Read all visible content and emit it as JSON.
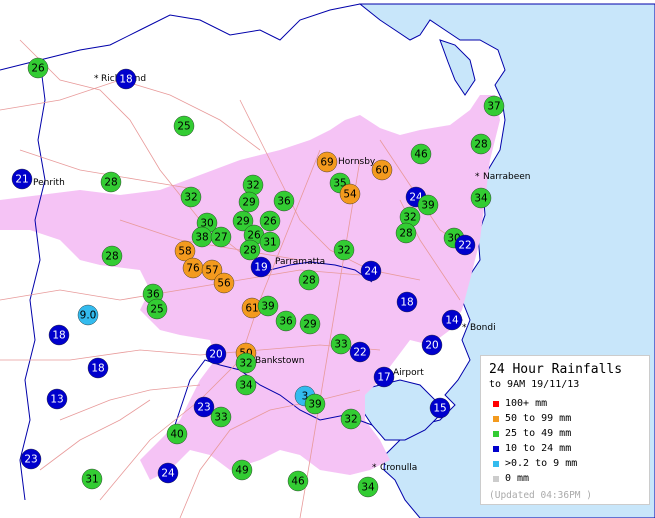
{
  "legend": {
    "title": "24 Hour Rainfalls",
    "subtitle": "to 9AM 19/11/13",
    "items": [
      {
        "label": "100+ mm",
        "color": "#ff0000"
      },
      {
        "label": "50  to 99 mm",
        "color": "#f39a1e"
      },
      {
        "label": "25  to 49 mm",
        "color": "#33cc33"
      },
      {
        "label": "10  to 24 mm",
        "color": "#0000cc"
      },
      {
        "label": ">0.2 to 9 mm",
        "color": "#33bbee"
      },
      {
        "label": "0 mm",
        "color": "#cccccc"
      }
    ],
    "updated": "(Updated 04:36PM  )"
  },
  "places": [
    "Richmond",
    "Penrith",
    "Narrabeen",
    "Hornsby",
    "Parramatta",
    "Bondi",
    "Bankstown",
    "Airport",
    "Cronulla"
  ],
  "stations": [
    "26",
    "18",
    "25",
    "37",
    "28",
    "69",
    "60",
    "46",
    "21",
    "28",
    "32",
    "32",
    "35",
    "54",
    "29",
    "36",
    "24",
    "39",
    "34",
    "30",
    "29",
    "26",
    "32",
    "28",
    "30",
    "38",
    "27",
    "26",
    "22",
    "31",
    "28",
    "58",
    "32",
    "28",
    "76",
    "57",
    "19",
    "28",
    "24",
    "56",
    "36",
    "25",
    "61",
    "39",
    "18",
    "14",
    "9.0",
    "36",
    "29",
    "18",
    "33",
    "20",
    "22",
    "20",
    "50",
    "32",
    "18",
    "17",
    "34",
    "13",
    "23",
    "3",
    "39",
    "33",
    "32",
    "15",
    "40",
    "23",
    "24",
    "49",
    "46",
    "31",
    "34"
  ]
}
